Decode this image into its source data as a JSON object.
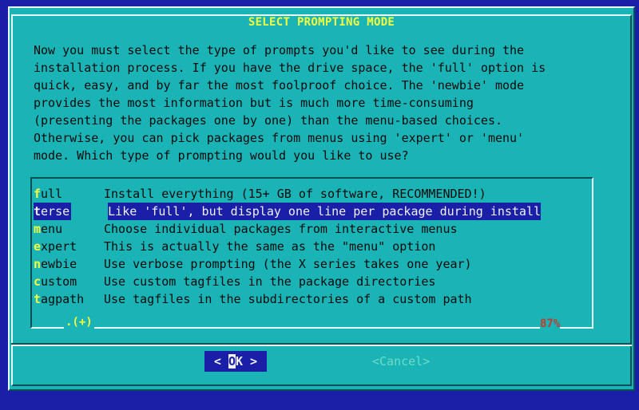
{
  "dialog": {
    "title": "SELECT PROMPTING MODE",
    "description": "Now you must select the type of prompts you'd like to see during the\ninstallation process. If you have the drive space, the 'full' option is\nquick, easy, and by far the most foolproof choice. The 'newbie' mode\nprovides the most information but is much more time-consuming\n(presenting the packages one by one) than the menu-based choices.\nOtherwise, you can pick packages from menus using 'expert' or 'menu'\nmode. Which type of prompting would you like to use?"
  },
  "options": [
    {
      "hot": "f",
      "rest": "ull",
      "desc": "Install everything (15+ GB of software, RECOMMENDED!)",
      "selected": false
    },
    {
      "hot": "t",
      "rest": "erse",
      "desc": "Like 'full', but display one line per package during install",
      "selected": true
    },
    {
      "hot": "m",
      "rest": "enu",
      "desc": "Choose individual packages from interactive menus",
      "selected": false
    },
    {
      "hot": "e",
      "rest": "xpert",
      "desc": "This is actually the same as the \"menu\" option",
      "selected": false
    },
    {
      "hot": "n",
      "rest": "ewbie",
      "desc": "Use verbose prompting (the X series takes one year)",
      "selected": false
    },
    {
      "hot": "c",
      "rest": "ustom",
      "desc": "Use custom tagfiles in the package directories",
      "selected": false
    },
    {
      "hot": "t",
      "rest": "agpath",
      "desc": "Use tagfiles in the subdirectories of a custom path",
      "selected": false
    }
  ],
  "scroll": {
    "indicator": ".(+)",
    "percent": "87%"
  },
  "buttons": {
    "ok_left": "< ",
    "ok_hot": "O",
    "ok_rest": "K >",
    "cancel": "<Cancel>"
  },
  "colors": {
    "background": "#1a1fa8",
    "dialog": "#1ab3b6",
    "hotkey": "#f6ff3c",
    "selected": "#1a1fa8",
    "percent": "#c43a2c"
  }
}
